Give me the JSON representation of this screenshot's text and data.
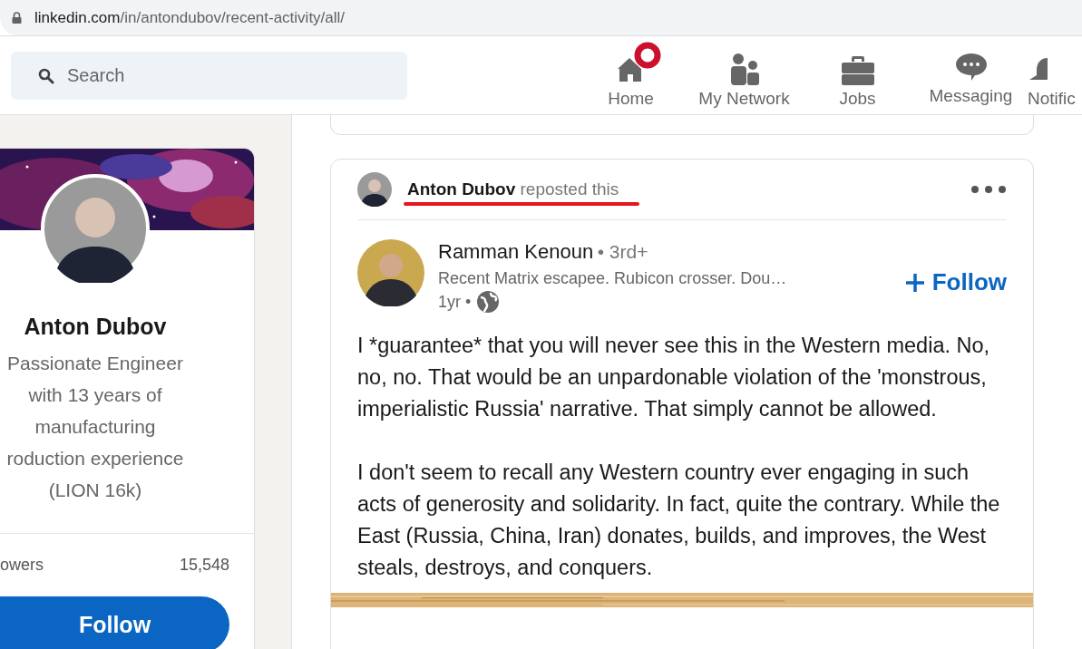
{
  "browser": {
    "address_host": "linkedin.com",
    "address_path": "/in/antondubov/recent-activity/all/"
  },
  "nav": {
    "search": {
      "placeholder": "Search"
    },
    "items": [
      {
        "label": "Home",
        "kind": "home",
        "badge": true
      },
      {
        "label": "My Network",
        "kind": "network",
        "badge": false
      },
      {
        "label": "Jobs",
        "kind": "jobs",
        "badge": false
      },
      {
        "label": "Messaging",
        "kind": "messaging",
        "badge": false
      },
      {
        "label": "Notific",
        "kind": "bell",
        "badge": false
      }
    ]
  },
  "profile": {
    "name": "Anton Dubov",
    "headline_lines": [
      "Passionate Engineer",
      "with 13 years of",
      "manufacturing",
      "roduction experience",
      "(LION 16k)"
    ],
    "stat_label": "owers",
    "stat_value": "15,548",
    "button": "Follow"
  },
  "post": {
    "reposter": "Anton Dubov",
    "repost_text": "reposted this",
    "underlined": true,
    "author": {
      "name": "Ramman Kenoun",
      "degree": "• 3rd+",
      "headline": "Recent Matrix escapee. Rubicon crosser. Dou…",
      "age": "1yr •"
    },
    "follow": "Follow",
    "paragraphs": [
      "I *guarantee* that you will never see this in the Western media. No, no, no. That would be an unpardonable violation of the 'monstrous, imperialistic Russia' narrative. That simply cannot be allowed.",
      "I don't seem to recall any Western country ever engaging in such acts of generosity and solidarity. In fact, quite the contrary. While the East (Russia, China, Iran) donates, builds, and improves, the West steals, destroys, and conquers."
    ]
  }
}
